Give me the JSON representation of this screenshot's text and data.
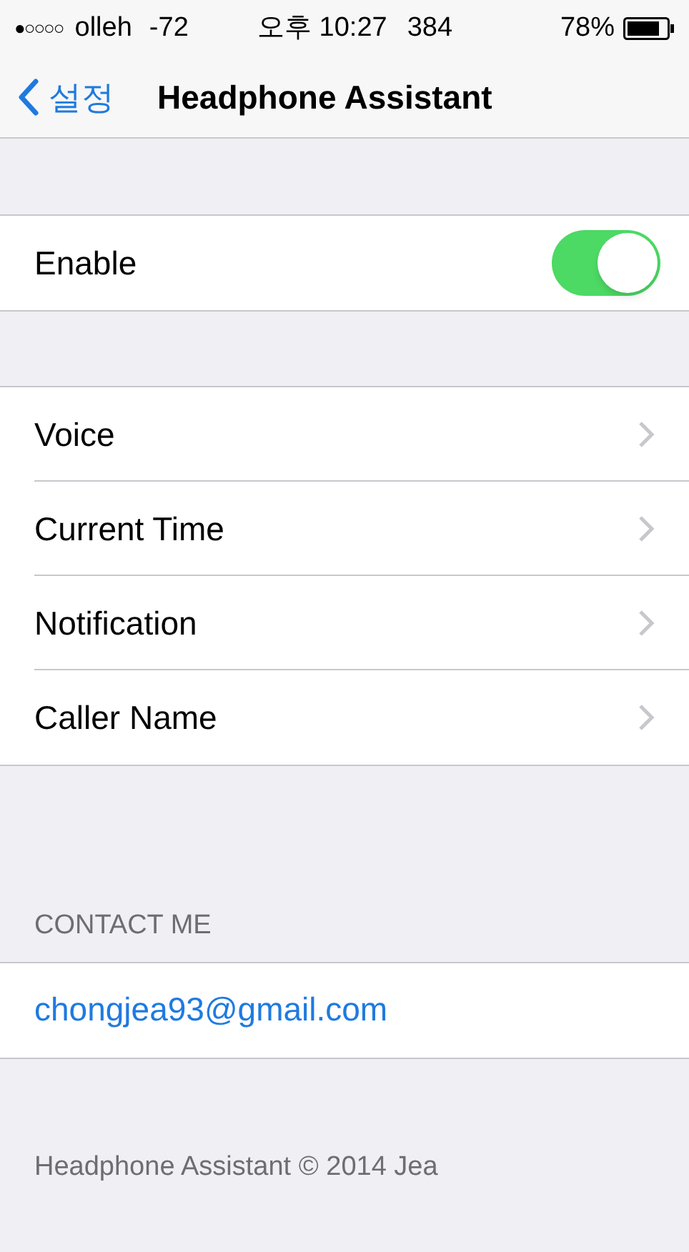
{
  "status_bar": {
    "signal": "●○○○○",
    "carrier": "olleh",
    "strength": "-72",
    "time": "오후 10:27",
    "extra": "384",
    "battery": "78%"
  },
  "nav": {
    "back": "설정",
    "title": "Headphone Assistant"
  },
  "enable": {
    "label": "Enable",
    "on": true
  },
  "menu": [
    {
      "label": "Voice"
    },
    {
      "label": "Current Time"
    },
    {
      "label": "Notification"
    },
    {
      "label": "Caller Name"
    }
  ],
  "contact": {
    "header": "CONTACT ME",
    "email": "chongjea93@gmail.com"
  },
  "footer": "Headphone Assistant © 2014 Jea"
}
